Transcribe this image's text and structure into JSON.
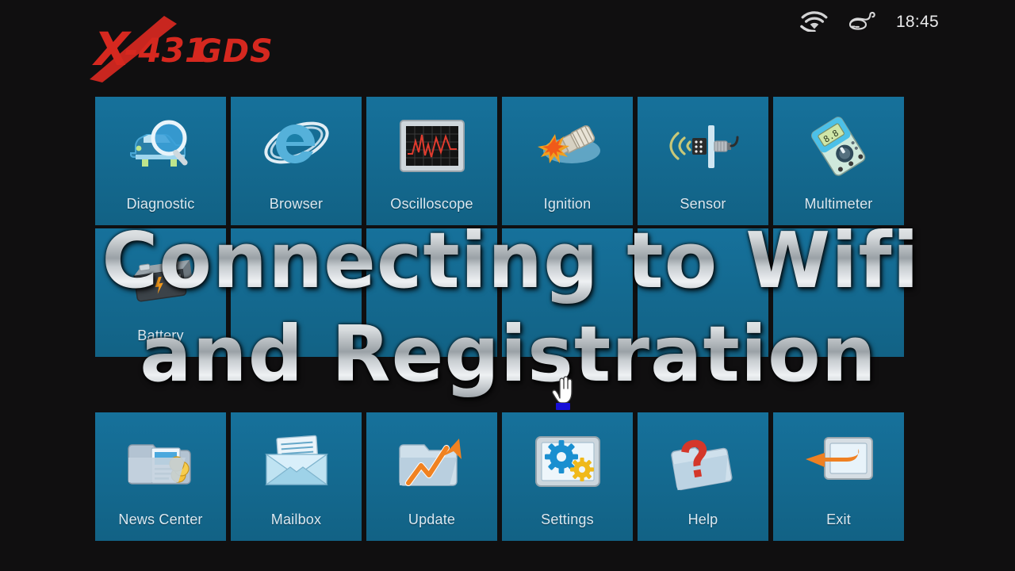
{
  "statusbar": {
    "wifi_icon": "wifi-icon",
    "mouse_icon": "mouse-icon",
    "time": "18:45"
  },
  "logo": {
    "text": "X-431 GDS",
    "mark": "X",
    "model": "-431",
    "suffix": "GDS",
    "color": "#d92b24"
  },
  "theme": {
    "background": "#100f10",
    "tile": "#16719b",
    "tile_label": "#dbe9f2",
    "accent_orange": "#ef8022",
    "accent_red": "#d92b24"
  },
  "grid": {
    "rows": [
      {
        "tiles": [
          {
            "label": "Diagnostic",
            "icon": "car-magnifier-icon"
          },
          {
            "label": "Browser",
            "icon": "internet-explorer-icon"
          },
          {
            "label": "Oscilloscope",
            "icon": "waveform-screen-icon"
          },
          {
            "label": "Ignition",
            "icon": "spark-plug-icon"
          },
          {
            "label": "Sensor",
            "icon": "sensor-probe-icon"
          },
          {
            "label": "Multimeter",
            "icon": "multimeter-icon"
          }
        ]
      },
      {
        "tiles": [
          {
            "label": "Battery",
            "icon": "battery-icon"
          },
          {
            "label": "",
            "icon": ""
          },
          {
            "label": "",
            "icon": ""
          },
          {
            "label": "",
            "icon": ""
          },
          {
            "label": "",
            "icon": ""
          },
          {
            "label": "",
            "icon": ""
          }
        ]
      },
      {
        "tiles": [
          {
            "label": "News Center",
            "icon": "news-folder-icon"
          },
          {
            "label": "Mailbox",
            "icon": "envelope-icon"
          },
          {
            "label": "Update",
            "icon": "update-folder-arrow-icon"
          },
          {
            "label": "Settings",
            "icon": "monitor-gears-icon"
          },
          {
            "label": "Help",
            "icon": "help-folder-question-icon"
          },
          {
            "label": "Exit",
            "icon": "exit-arrow-monitor-icon"
          }
        ]
      }
    ]
  },
  "caption": {
    "line1": "Connecting to Wifi",
    "line2": "and Registration"
  },
  "cursor": {
    "type": "hand-pointer-cursor"
  }
}
